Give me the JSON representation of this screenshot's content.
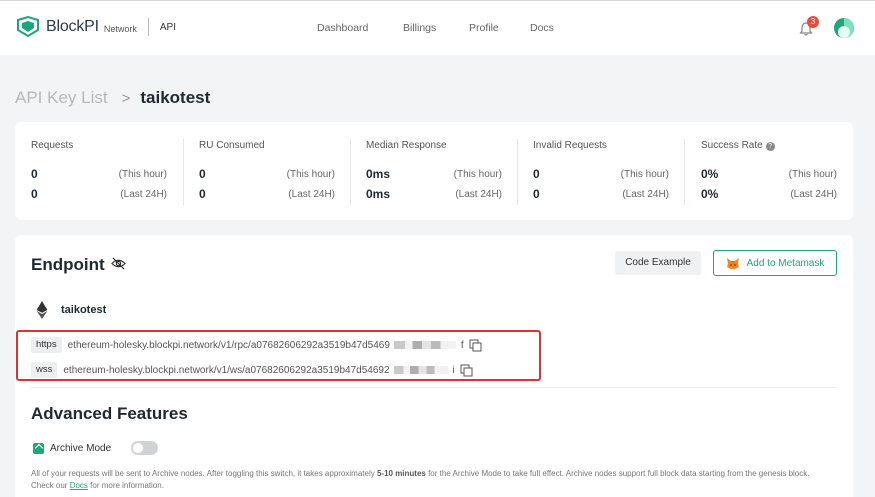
{
  "nav": {
    "brand": "BlockPI",
    "network": "Network",
    "api": "API",
    "links": [
      "Dashboard",
      "Billings",
      "Profile",
      "Docs"
    ],
    "notifications": "3"
  },
  "breadcrumb": {
    "parent": "API Key List",
    "separator": ">",
    "current": "taikotest"
  },
  "stats": [
    {
      "title": "Requests",
      "hour": "0",
      "day": "0"
    },
    {
      "title": "RU Consumed",
      "hour": "0",
      "day": "0"
    },
    {
      "title": "Median Response",
      "hour": "0ms",
      "day": "0ms"
    },
    {
      "title": "Invalid Requests",
      "hour": "0",
      "day": "0"
    },
    {
      "title": "Success Rate",
      "hour": "0%",
      "day": "0%"
    }
  ],
  "periods": {
    "hour": "(This hour)",
    "day": "(Last 24H)"
  },
  "endpoint": {
    "title": "Endpoint",
    "code_example": "Code Example",
    "add_metamask": "Add to Metamask",
    "network_name": "taikotest",
    "https_label": "https",
    "https_url": "ethereum-holesky.blockpi.network/v1/rpc/a07682606292a3519b47d5469",
    "https_tail": "f",
    "wss_label": "wss",
    "wss_url": "ethereum-holesky.blockpi.network/v1/ws/a07682606292a3519b47d54692",
    "wss_tail": "i"
  },
  "advanced": {
    "title": "Advanced Features",
    "archive_label": "Archive Mode",
    "desc_1": "All of your requests will be sent to Archive nodes. After toggling this switch, it takes approximately ",
    "desc_bold": "5-10 minutes",
    "desc_2": " for the Archive Mode to take full effect. Archive nodes support full block data starting from the genesis block. Check our ",
    "desc_link": "Docs",
    "desc_3": " for more information."
  },
  "colors": {
    "accent": "#1fa67a",
    "highlight": "#e03131",
    "badge": "#e74c3c"
  }
}
